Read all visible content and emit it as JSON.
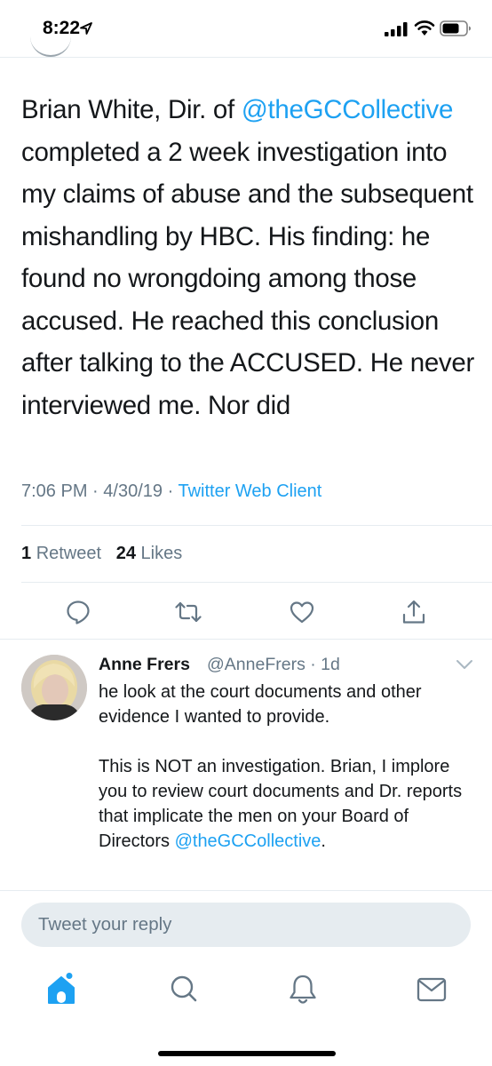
{
  "status_bar": {
    "time": "8:22",
    "icons": [
      "location-arrow-icon",
      "cellular-signal-icon",
      "wifi-icon",
      "battery-icon"
    ]
  },
  "tweet": {
    "text_before_mention": "Brian White, Dir. of ",
    "mention": "@theGCCollective",
    "text_after_mention": " completed a 2 week investigation into my claims of abuse and the subsequent mishandling by HBC. His finding: he found no wrongdoing among those accused. He reached this conclusion after talking to the ACCUSED. He never interviewed me. Nor did",
    "time": "7:06 PM",
    "date": "4/30/19",
    "separator": "·",
    "client": "Twitter Web Client",
    "retweet_count": "1",
    "retweet_label": "Retweet",
    "like_count": "24",
    "like_label": "Likes",
    "actions": [
      "reply-icon",
      "retweet-icon",
      "like-icon",
      "share-icon"
    ]
  },
  "reply": {
    "name": "Anne Frers",
    "handle": "@AnneFrers",
    "age": "· 1d",
    "paragraph1": "he look at the court documents and other evidence I wanted to provide.",
    "paragraph2_text": "This is NOT an investigation. Brian, I implore you to review court documents and Dr. reports that implicate the men on your Board of Directors ",
    "paragraph2_mention": "@theGCCollective",
    "paragraph2_end": "."
  },
  "compose": {
    "placeholder": "Tweet your reply"
  },
  "tab_bar": {
    "items": [
      "home-icon",
      "search-icon",
      "notifications-icon",
      "messages-icon"
    ]
  },
  "colors": {
    "accent": "#1da1f2",
    "secondary_text": "#657786",
    "divider": "#e6ecf0",
    "text": "#14171a"
  }
}
